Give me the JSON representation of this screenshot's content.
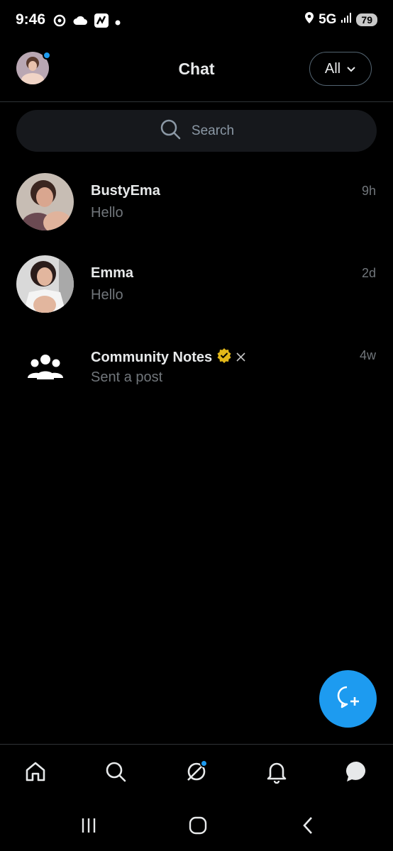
{
  "status_bar": {
    "time": "9:46",
    "network": "5G",
    "battery": "79"
  },
  "header": {
    "title": "Chat",
    "filter_label": "All"
  },
  "search": {
    "placeholder": "Search"
  },
  "conversations": [
    {
      "name": "BustyEma",
      "preview": "Hello",
      "time": "9h",
      "avatar": "user-photo"
    },
    {
      "name": "Emma",
      "preview": "Hello",
      "time": "2d",
      "avatar": "user-photo"
    },
    {
      "name": "Community Notes",
      "preview": "Sent a post",
      "time": "4w",
      "avatar": "community-group-icon",
      "verified": true,
      "badge": "x-logo"
    }
  ],
  "bottom_nav": {
    "items": [
      "home-icon",
      "search-icon",
      "grok-icon",
      "notifications-icon",
      "messages-icon"
    ]
  },
  "colors": {
    "accent": "#1d9bf0",
    "background": "#000000",
    "secondary_text": "#71767b",
    "verified_gold": "#e2b719"
  }
}
